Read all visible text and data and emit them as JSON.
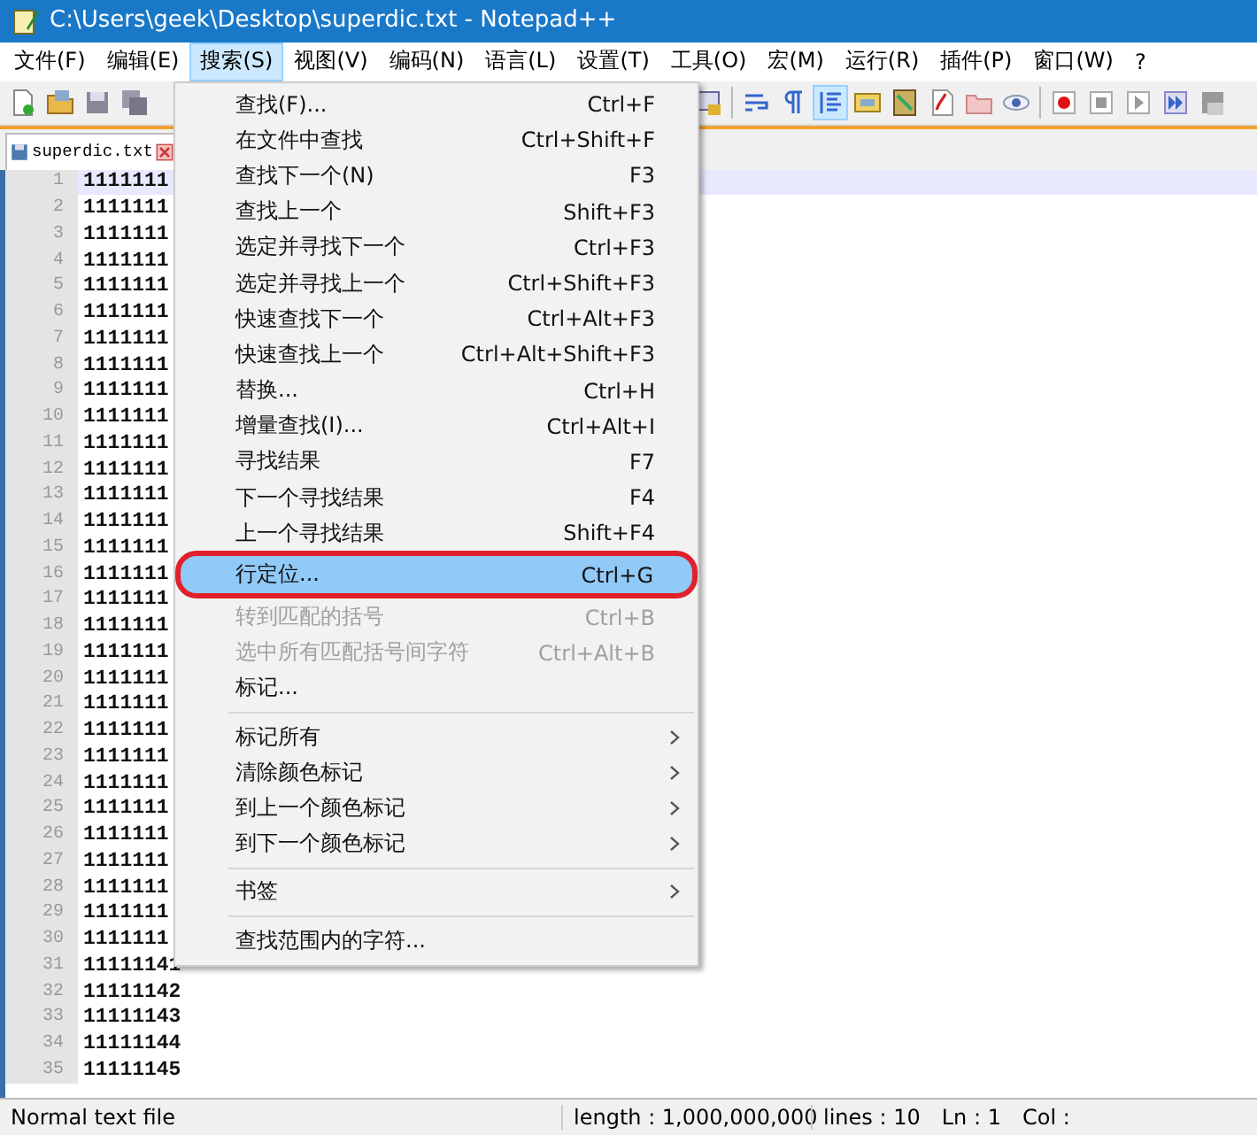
{
  "window": {
    "title": "C:\\Users\\geek\\Desktop\\superdic.txt - Notepad++"
  },
  "menubar": [
    {
      "label": "文件(F)",
      "selected": false
    },
    {
      "label": "编辑(E)",
      "selected": false
    },
    {
      "label": "搜索(S)",
      "selected": true
    },
    {
      "label": "视图(V)",
      "selected": false
    },
    {
      "label": "编码(N)",
      "selected": false
    },
    {
      "label": "语言(L)",
      "selected": false
    },
    {
      "label": "设置(T)",
      "selected": false
    },
    {
      "label": "工具(O)",
      "selected": false
    },
    {
      "label": "宏(M)",
      "selected": false
    },
    {
      "label": "运行(R)",
      "selected": false
    },
    {
      "label": "插件(P)",
      "selected": false
    },
    {
      "label": "窗口(W)",
      "selected": false
    },
    {
      "label": "?",
      "selected": false
    }
  ],
  "tabs": [
    {
      "label": "superdic.txt",
      "selected": true
    }
  ],
  "editor": {
    "lines": [
      {
        "number": "1",
        "text": "1111111",
        "current": true
      },
      {
        "number": "2",
        "text": "1111111",
        "current": false
      },
      {
        "number": "3",
        "text": "1111111",
        "current": false
      },
      {
        "number": "4",
        "text": "1111111",
        "current": false
      },
      {
        "number": "5",
        "text": "1111111",
        "current": false
      },
      {
        "number": "6",
        "text": "1111111",
        "current": false
      },
      {
        "number": "7",
        "text": "1111111",
        "current": false
      },
      {
        "number": "8",
        "text": "1111111",
        "current": false
      },
      {
        "number": "9",
        "text": "1111111",
        "current": false
      },
      {
        "number": "10",
        "text": "1111111",
        "current": false
      },
      {
        "number": "11",
        "text": "1111111",
        "current": false
      },
      {
        "number": "12",
        "text": "1111111",
        "current": false
      },
      {
        "number": "13",
        "text": "1111111",
        "current": false
      },
      {
        "number": "14",
        "text": "1111111",
        "current": false
      },
      {
        "number": "15",
        "text": "1111111",
        "current": false
      },
      {
        "number": "16",
        "text": "1111111",
        "current": false
      },
      {
        "number": "17",
        "text": "1111111",
        "current": false
      },
      {
        "number": "18",
        "text": "1111111",
        "current": false
      },
      {
        "number": "19",
        "text": "1111111",
        "current": false
      },
      {
        "number": "20",
        "text": "1111111",
        "current": false
      },
      {
        "number": "21",
        "text": "1111111",
        "current": false
      },
      {
        "number": "22",
        "text": "1111111",
        "current": false
      },
      {
        "number": "23",
        "text": "1111111",
        "current": false
      },
      {
        "number": "24",
        "text": "1111111",
        "current": false
      },
      {
        "number": "25",
        "text": "1111111",
        "current": false
      },
      {
        "number": "26",
        "text": "1111111",
        "current": false
      },
      {
        "number": "27",
        "text": "1111111",
        "current": false
      },
      {
        "number": "28",
        "text": "1111111",
        "current": false
      },
      {
        "number": "29",
        "text": "1111111",
        "current": false
      },
      {
        "number": "30",
        "text": "1111111",
        "current": false
      },
      {
        "number": "31",
        "text": "11111141",
        "current": false
      },
      {
        "number": "32",
        "text": "11111142",
        "current": false
      },
      {
        "number": "33",
        "text": "11111143",
        "current": false
      },
      {
        "number": "34",
        "text": "11111144",
        "current": false
      },
      {
        "number": "35",
        "text": "11111145",
        "current": false
      }
    ]
  },
  "search_menu": [
    {
      "kind": "item",
      "label": "查找(F)...",
      "shortcut": "Ctrl+F",
      "selected": false,
      "disabled": false,
      "circled": false
    },
    {
      "kind": "item",
      "label": "在文件中查找",
      "shortcut": "Ctrl+Shift+F",
      "selected": false,
      "disabled": false,
      "circled": false
    },
    {
      "kind": "item",
      "label": "查找下一个(N)",
      "shortcut": "F3",
      "selected": false,
      "disabled": false,
      "circled": false
    },
    {
      "kind": "item",
      "label": "查找上一个",
      "shortcut": "Shift+F3",
      "selected": false,
      "disabled": false,
      "circled": false
    },
    {
      "kind": "item",
      "label": "选定并寻找下一个",
      "shortcut": "Ctrl+F3",
      "selected": false,
      "disabled": false,
      "circled": false
    },
    {
      "kind": "item",
      "label": "选定并寻找上一个",
      "shortcut": "Ctrl+Shift+F3",
      "selected": false,
      "disabled": false,
      "circled": false
    },
    {
      "kind": "item",
      "label": "快速查找下一个",
      "shortcut": "Ctrl+Alt+F3",
      "selected": false,
      "disabled": false,
      "circled": false
    },
    {
      "kind": "item",
      "label": "快速查找上一个",
      "shortcut": "Ctrl+Alt+Shift+F3",
      "selected": false,
      "disabled": false,
      "circled": false
    },
    {
      "kind": "item",
      "label": "替换...",
      "shortcut": "Ctrl+H",
      "selected": false,
      "disabled": false,
      "circled": false
    },
    {
      "kind": "item",
      "label": "增量查找(I)...",
      "shortcut": "Ctrl+Alt+I",
      "selected": false,
      "disabled": false,
      "circled": false
    },
    {
      "kind": "item",
      "label": "寻找结果",
      "shortcut": "F7",
      "selected": false,
      "disabled": false,
      "circled": false
    },
    {
      "kind": "item",
      "label": "下一个寻找结果",
      "shortcut": "F4",
      "selected": false,
      "disabled": false,
      "circled": false
    },
    {
      "kind": "item",
      "label": "上一个寻找结果",
      "shortcut": "Shift+F4",
      "selected": false,
      "disabled": false,
      "circled": false
    },
    {
      "kind": "item",
      "label": "行定位...",
      "shortcut": "Ctrl+G",
      "selected": true,
      "disabled": false,
      "circled": true
    },
    {
      "kind": "item",
      "label": "转到匹配的括号",
      "shortcut": "Ctrl+B",
      "selected": false,
      "disabled": true,
      "circled": false
    },
    {
      "kind": "item",
      "label": "选中所有匹配括号间字符",
      "shortcut": "Ctrl+Alt+B",
      "selected": false,
      "disabled": true,
      "circled": false
    },
    {
      "kind": "item",
      "label": "标记...",
      "selected": false,
      "disabled": false,
      "circled": false
    },
    {
      "kind": "separator"
    },
    {
      "kind": "submenu",
      "label": "标记所有",
      "selected": false,
      "disabled": false,
      "circled": false
    },
    {
      "kind": "submenu",
      "label": "清除颜色标记",
      "selected": false,
      "disabled": false,
      "circled": false
    },
    {
      "kind": "submenu",
      "label": "到上一个颜色标记",
      "selected": false,
      "disabled": false,
      "circled": false
    },
    {
      "kind": "submenu",
      "label": "到下一个颜色标记",
      "selected": false,
      "disabled": false,
      "circled": false
    },
    {
      "kind": "separator"
    },
    {
      "kind": "submenu",
      "label": "书签",
      "selected": false,
      "disabled": false,
      "circled": false
    },
    {
      "kind": "separator"
    },
    {
      "kind": "item",
      "label": "查找范围内的字符...",
      "selected": false,
      "disabled": false,
      "circled": false
    }
  ],
  "status_bar": {
    "file_type": "Normal text file",
    "length": "length : 1,000,000,000",
    "lines": "lines : 10",
    "position": "Ln : 1",
    "column": "Col :"
  }
}
